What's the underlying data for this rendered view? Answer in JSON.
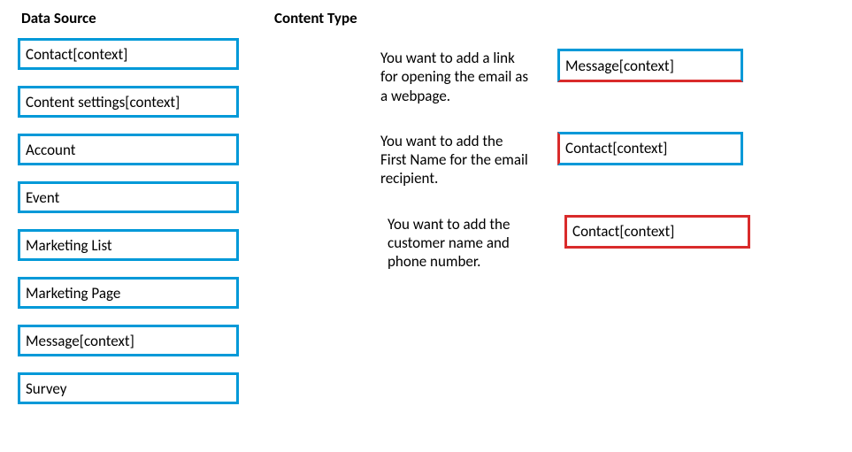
{
  "headings": {
    "data_source": "Data Source",
    "content_type": "Content Type"
  },
  "sources": [
    "Contact[context]",
    "Content settings[context]",
    "Account",
    "Event",
    "Marketing List",
    "Marketing Page",
    "Message[context]",
    "Survey"
  ],
  "rows": [
    {
      "description": "You want to add a link for opening the email as a webpage.",
      "answer": "Message[context]"
    },
    {
      "description": "You want to add the First Name for the email recipient.",
      "answer": "Contact[context]"
    },
    {
      "description": "You want to add the customer name and phone number.",
      "answer": "Contact[context]"
    }
  ]
}
